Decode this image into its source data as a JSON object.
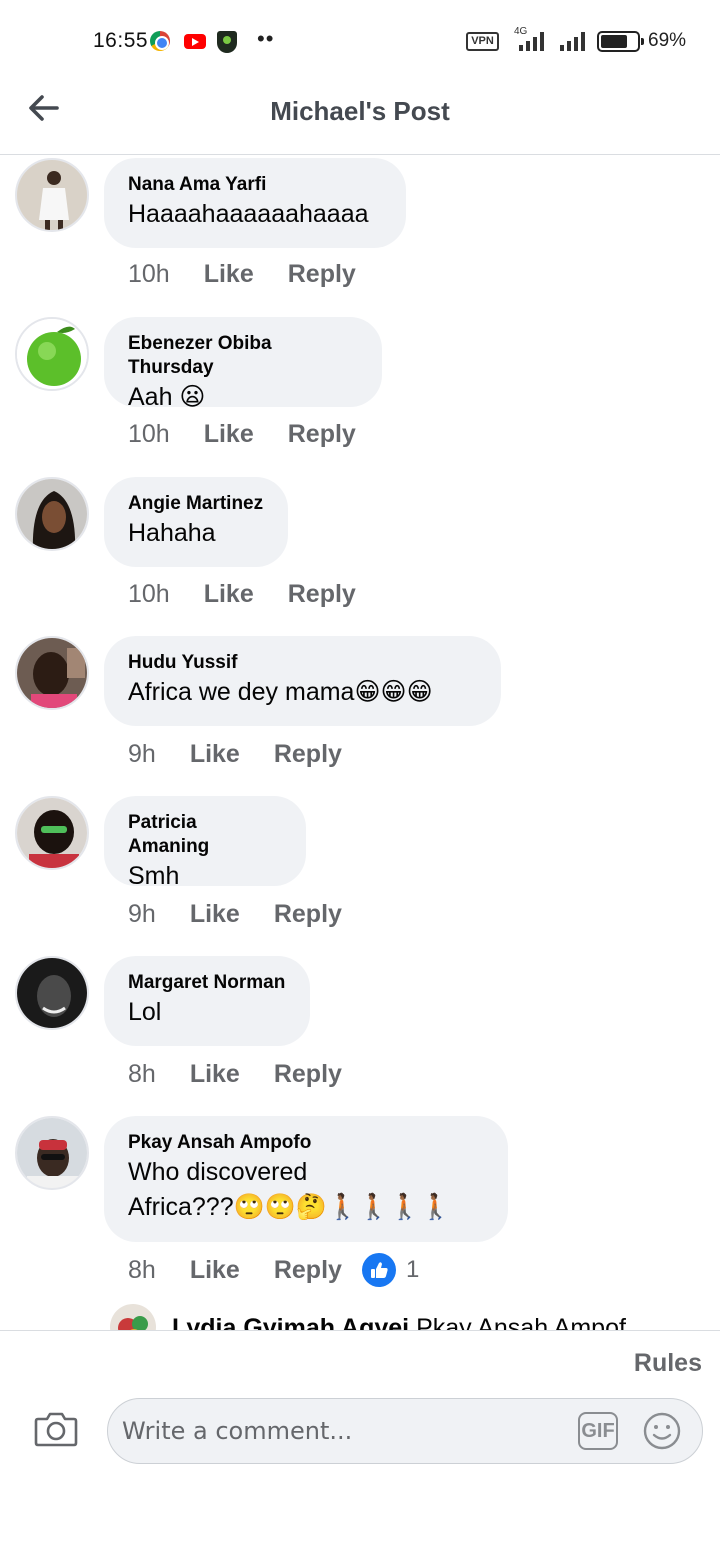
{
  "status_bar": {
    "time": "16:55",
    "dots": "••",
    "vpn": "VPN",
    "network": "4G",
    "battery": "69%"
  },
  "header": {
    "title": "Michael's Post"
  },
  "comments": [
    {
      "author": "Nana Ama Yarfi",
      "text": "Haaaahaaaaaahaaaa",
      "time": "10h",
      "like": "Like",
      "reply": "Reply"
    },
    {
      "author": "Ebenezer Obiba Thursday",
      "text": "Aah 😦",
      "time": "10h",
      "like": "Like",
      "reply": "Reply"
    },
    {
      "author": "Angie Martinez",
      "text": "Hahaha",
      "time": "10h",
      "like": "Like",
      "reply": "Reply"
    },
    {
      "author": "Hudu Yussif",
      "text": "Africa we dey mama😁😁😁",
      "time": "9h",
      "like": "Like",
      "reply": "Reply"
    },
    {
      "author": "Patricia Amaning",
      "text": "Smh",
      "time": "9h",
      "like": "Like",
      "reply": "Reply"
    },
    {
      "author": "Margaret Norman",
      "text": "Lol",
      "time": "8h",
      "like": "Like",
      "reply": "Reply"
    },
    {
      "author": "Pkay Ansah Ampofo",
      "text": "Who discovered\nAfrica???🙄🙄🤔🚶🏾🚶🏾🚶🏾🚶🏾",
      "time": "8h",
      "like": "Like",
      "reply": "Reply",
      "reaction_count": "1"
    }
  ],
  "reply_preview": {
    "author": "Lydia Gyimah Agyei",
    "text": "Pkay Ansah Ampof"
  },
  "footer": {
    "rules": "Rules",
    "composer_placeholder": "Write a comment...",
    "gif": "GIF"
  },
  "colors": {
    "bubble": "#f0f2f5",
    "meta_text": "#65676b",
    "like_blue": "#1877f2"
  }
}
